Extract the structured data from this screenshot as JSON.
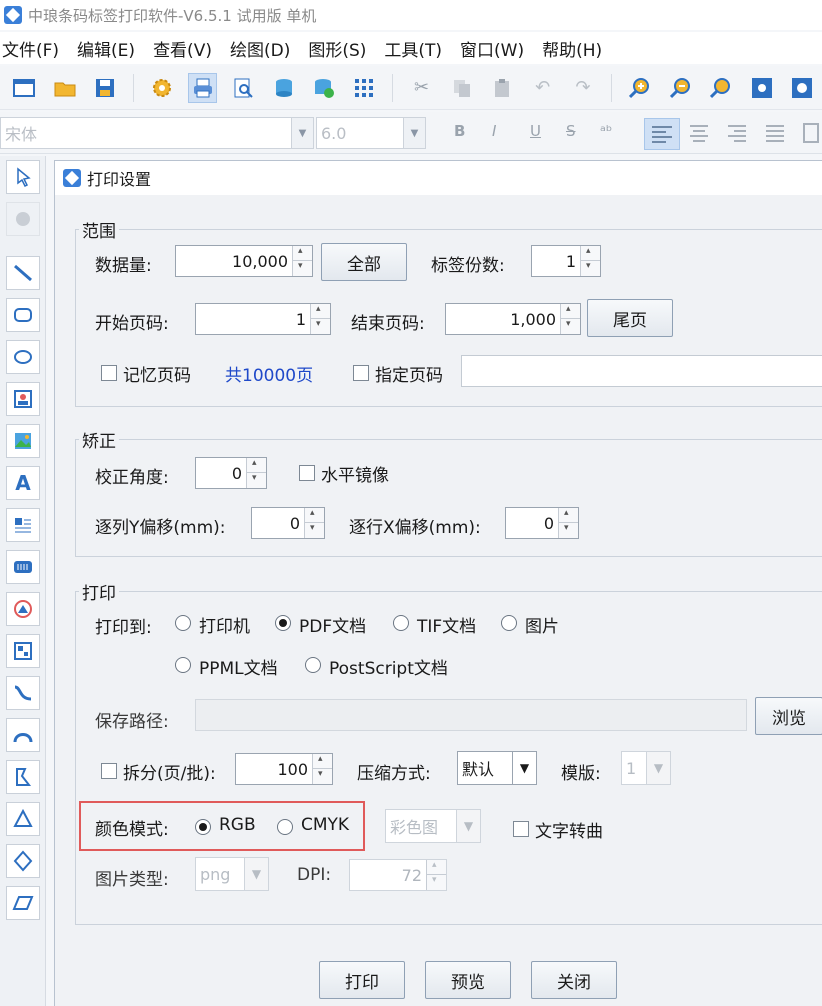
{
  "app": {
    "title": "中琅条码标签打印软件-V6.5.1 试用版 单机"
  },
  "menu": [
    "文件(F)",
    "编辑(E)",
    "查看(V)",
    "绘图(D)",
    "图形(S)",
    "工具(T)",
    "窗口(W)",
    "帮助(H)"
  ],
  "format_bar": {
    "font": "宋体",
    "size": "6.0",
    "bold": "B",
    "italic": "I",
    "underline": "U",
    "strike": "S"
  },
  "dialog": {
    "title": "打印设置",
    "range": {
      "legend": "范围",
      "data_count_label": "数据量:",
      "data_count_value": "10,000",
      "all_button": "全部",
      "copies_label": "标签份数:",
      "copies_value": "1",
      "start_page_label": "开始页码:",
      "start_page_value": "1",
      "end_page_label": "结束页码:",
      "end_page_value": "1,000",
      "last_page_button": "尾页",
      "remember_page_label": "记忆页码",
      "total_pages": "共10000页",
      "specify_page_label": "指定页码"
    },
    "correction": {
      "legend": "矫正",
      "angle_label": "校正角度:",
      "angle_value": "0",
      "mirror_label": "水平镜像",
      "y_offset_label": "逐列Y偏移(mm):",
      "y_offset_value": "0",
      "x_offset_label": "逐行X偏移(mm):",
      "x_offset_value": "0"
    },
    "print": {
      "legend": "打印",
      "print_to_label": "打印到:",
      "targets": [
        "打印机",
        "PDF文档",
        "TIF文档",
        "图片",
        "PPML文档",
        "PostScript文档"
      ],
      "selected_target": "PDF文档",
      "save_path_label": "保存路径:",
      "browse_button": "浏览",
      "split_label": "拆分(页/批):",
      "split_value": "100",
      "compression_label": "压缩方式:",
      "compression_value": "默认",
      "template_label": "模版:",
      "template_value": "1",
      "color_mode_label": "颜色模式:",
      "color_modes": [
        "RGB",
        "CMYK"
      ],
      "selected_color_mode": "RGB",
      "color_image_value": "彩色图",
      "text_to_curve_label": "文字转曲",
      "image_type_label": "图片类型:",
      "image_type_value": "png",
      "dpi_label": "DPI:",
      "dpi_value": "72"
    },
    "buttons": {
      "print": "打印",
      "preview": "预览",
      "close": "关闭"
    }
  },
  "colors": {
    "highlight_border": "#e05a5a",
    "total_pages_text": "#1f49c9",
    "accent": "#3a7fd8"
  }
}
